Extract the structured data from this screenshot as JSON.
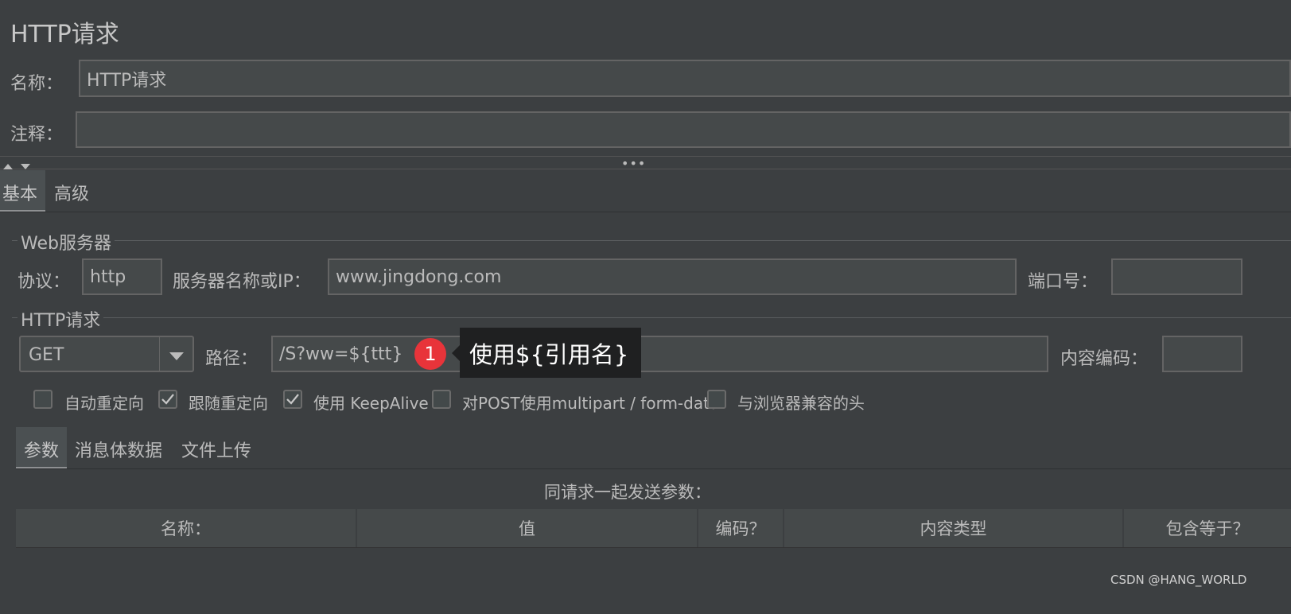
{
  "panel_title": "HTTP请求",
  "name_label": "名称：",
  "name_value": "HTTP请求",
  "comment_label": "注释：",
  "comment_value": "",
  "splitter_dots": "•••",
  "tabs": [
    {
      "label": "基本",
      "active": true
    },
    {
      "label": "高级",
      "active": false
    }
  ],
  "web_server": {
    "group_title": "Web服务器",
    "protocol_label": "协议：",
    "protocol_value": "http",
    "server_label": "服务器名称或IP：",
    "server_value": "www.jingdong.com",
    "port_label": "端口号：",
    "port_value": ""
  },
  "http_request": {
    "group_title": "HTTP请求",
    "method_value": "GET",
    "path_label": "路径：",
    "path_value": "/S?ww=${ttt}",
    "encoding_label": "内容编码：",
    "encoding_value": ""
  },
  "annotation": {
    "badge": "1",
    "tooltip": "使用${引用名}",
    "badge_color": "#e8343a"
  },
  "checkboxes": [
    {
      "label": "自动重定向",
      "checked": false
    },
    {
      "label": "跟随重定向",
      "checked": true
    },
    {
      "label": "使用 KeepAlive",
      "checked": true
    },
    {
      "label": "对POST使用multipart / form-data",
      "checked": false
    },
    {
      "label": "与浏览器兼容的头",
      "checked": false
    }
  ],
  "sub_tabs": [
    {
      "label": "参数",
      "active": true
    },
    {
      "label": "消息体数据",
      "active": false
    },
    {
      "label": "文件上传",
      "active": false
    }
  ],
  "params_caption": "同请求一起发送参数：",
  "table_headers": [
    "名称：",
    "值",
    "编码？",
    "内容类型",
    "包含等于？"
  ],
  "watermark": "CSDN @HANG_WORLD"
}
